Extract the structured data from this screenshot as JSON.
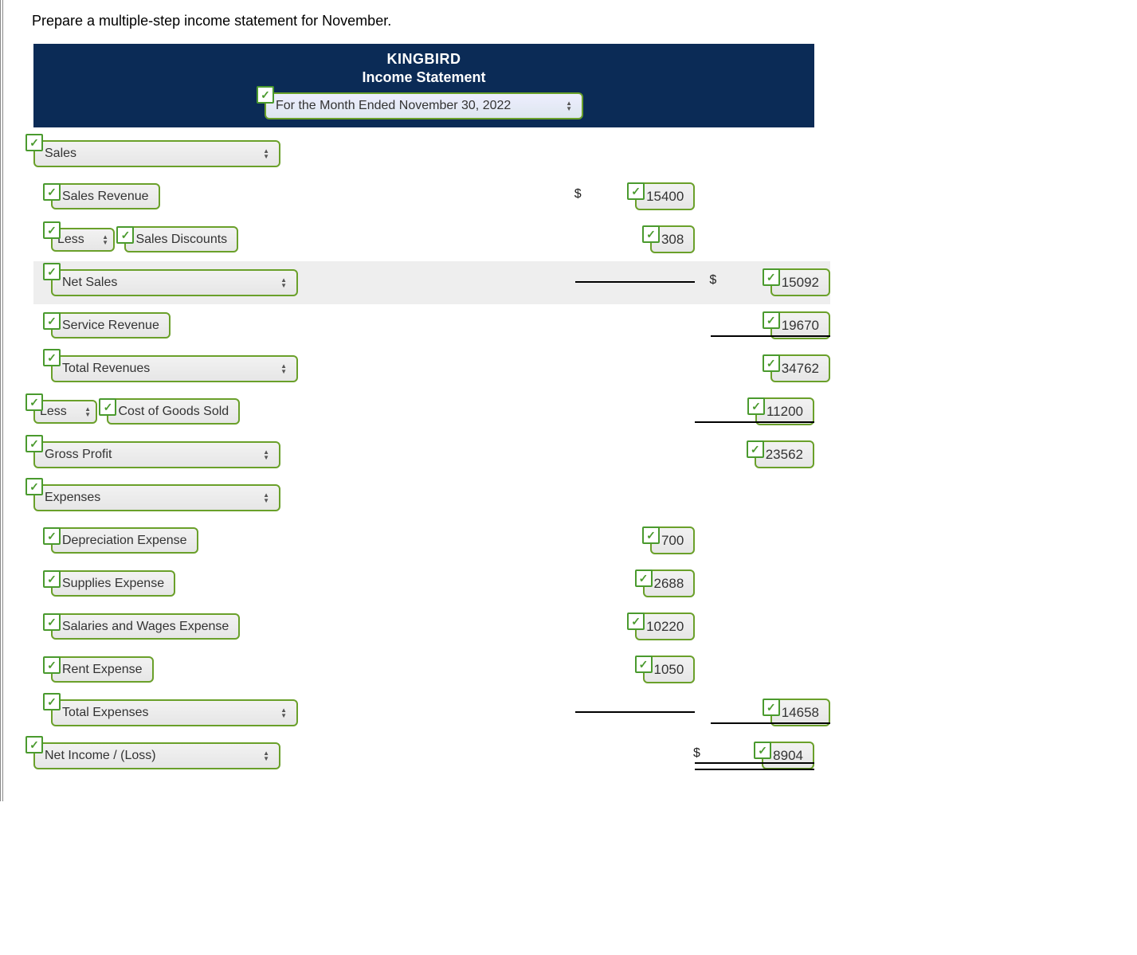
{
  "instruction": "Prepare a multiple-step income statement for November.",
  "header": {
    "company": "KINGBIRD",
    "title": "Income Statement",
    "period": "For the Month Ended November 30, 2022"
  },
  "less_label": "Less",
  "dollar": "$",
  "lines": {
    "sales": "Sales",
    "sales_revenue": "Sales Revenue",
    "sales_discounts": "Sales Discounts",
    "net_sales": "Net Sales",
    "service_revenue": "Service Revenue",
    "total_revenues": "Total Revenues",
    "cogs": "Cost of Goods Sold",
    "gross_profit": "Gross Profit",
    "expenses": "Expenses",
    "depreciation": "Depreciation Expense",
    "supplies": "Supplies Expense",
    "salaries": "Salaries and Wages Expense",
    "rent": "Rent Expense",
    "total_expenses": "Total Expenses",
    "net_income": "Net Income / (Loss)"
  },
  "amounts": {
    "sales_revenue": "15400",
    "sales_discounts": "308",
    "net_sales": "15092",
    "service_revenue": "19670",
    "total_revenues": "34762",
    "cogs": "11200",
    "gross_profit": "23562",
    "depreciation": "700",
    "supplies": "2688",
    "salaries": "10220",
    "rent": "1050",
    "total_expenses": "14658",
    "net_income": "8904"
  }
}
